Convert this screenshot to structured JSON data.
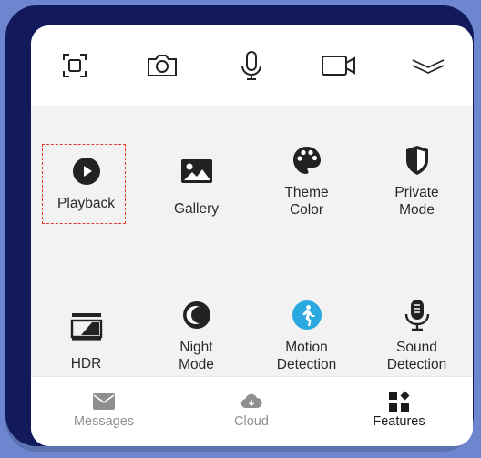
{
  "toolbar": {
    "icons": [
      "screenshot-icon",
      "camera-icon",
      "microphone-icon",
      "video-camera-icon",
      "collapse-icon"
    ]
  },
  "features": {
    "items": [
      {
        "label": "Playback",
        "icon": "play-icon",
        "selected": true
      },
      {
        "label": "Gallery",
        "icon": "image-icon"
      },
      {
        "label": "Theme\nColor",
        "icon": "palette-icon"
      },
      {
        "label": "Private\nMode",
        "icon": "shield-icon"
      },
      {
        "label": "HDR",
        "icon": "hdr-icon"
      },
      {
        "label": "Night\nMode",
        "icon": "moon-icon"
      },
      {
        "label": "Motion\nDetection",
        "icon": "motion-icon"
      },
      {
        "label": "Sound\nDetection",
        "icon": "mic-icon"
      }
    ]
  },
  "tabs": {
    "messages": "Messages",
    "cloud": "Cloud",
    "features": "Features"
  },
  "colors": {
    "selection_border": "#e23b2e",
    "motion_accent": "#29a9e0",
    "active_tab": "#1a1a1a",
    "inactive_tab": "#8f8f8f"
  }
}
